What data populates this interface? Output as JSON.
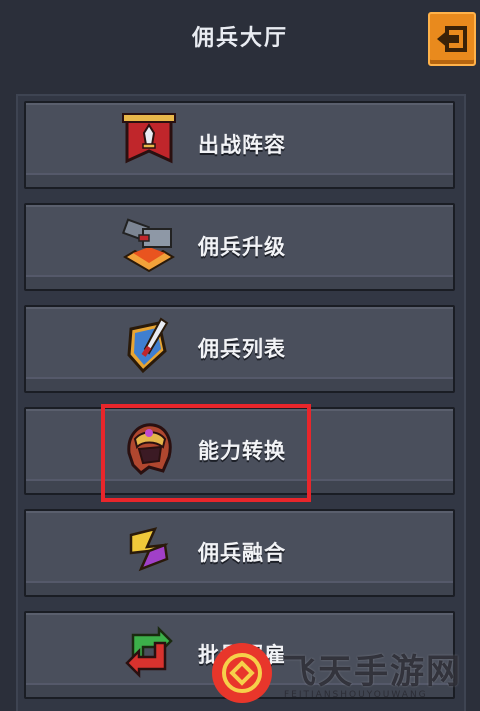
{
  "header": {
    "title": "佣兵大厅",
    "back_icon": "back-arrow-icon"
  },
  "menu": [
    {
      "id": "lineup",
      "label": "出战阵容",
      "icon": "banner-sword-icon"
    },
    {
      "id": "upgrade",
      "label": "佣兵升级",
      "icon": "anvil-hammer-icon"
    },
    {
      "id": "list",
      "label": "佣兵列表",
      "icon": "shield-sword-icon"
    },
    {
      "id": "ability",
      "label": "能力转换",
      "icon": "helmet-icon"
    },
    {
      "id": "fusion",
      "label": "佣兵融合",
      "icon": "fusion-arrow-icon"
    },
    {
      "id": "dismiss",
      "label": "批量解雇",
      "icon": "recycle-arrows-icon"
    }
  ],
  "watermark": {
    "text": "飞天手游网",
    "sub": "FEITIANSHOUYOUWANG"
  },
  "colors": {
    "accent": "#e98a1d",
    "highlight": "#e8262b",
    "background": "#2b2f3a"
  }
}
